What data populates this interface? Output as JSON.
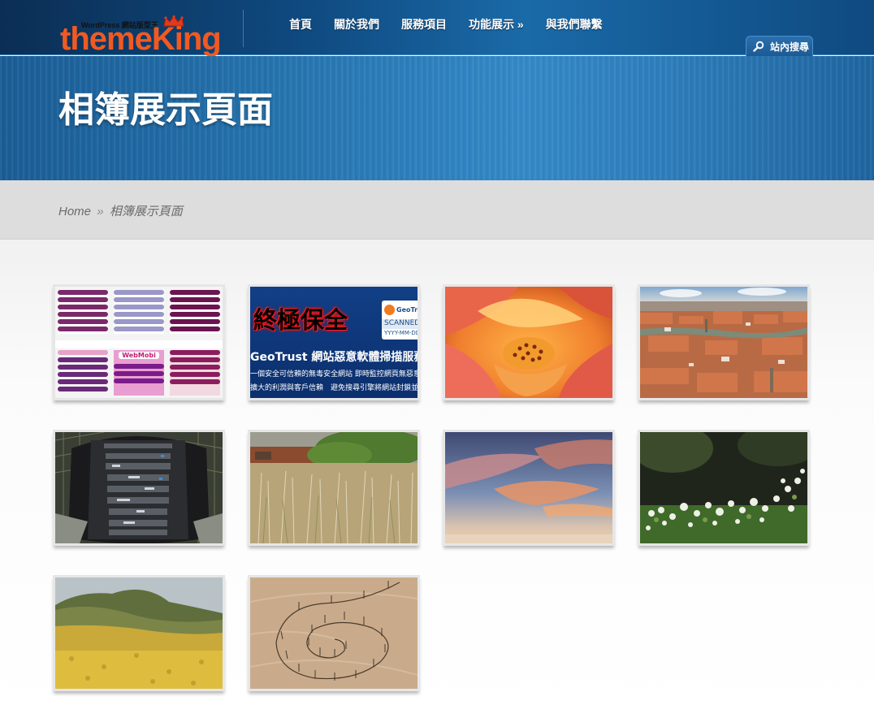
{
  "header": {
    "logo_tagline": "WordPress 網站版型王",
    "logo_text": "themeKing",
    "nav": [
      {
        "label": "首頁"
      },
      {
        "label": "關於我們"
      },
      {
        "label": "服務項目"
      },
      {
        "label": "功能展示 »"
      },
      {
        "label": "與我們聯繫"
      }
    ],
    "search_label": "站內搜尋"
  },
  "banner": {
    "title": "相簿展示頁面"
  },
  "breadcrumb": {
    "home": "Home",
    "separator": "»",
    "current": "相簿展示頁面"
  },
  "gallery": {
    "items": [
      {
        "subject": "website-screenshots",
        "texts": {
          "brand": "WebMobi"
        }
      },
      {
        "subject": "geotrust-banner",
        "texts": {
          "headline": "終極保全",
          "badge_brand": "GeoTrust",
          "badge_status": "SCANNED",
          "badge_date": "YYYY-MM-DD",
          "line1": "GeoTrust 網站惡意軟體掃描服務",
          "line2": "一個安全可信賴的無毒安全網站 即時監控網頁無惡意",
          "line3": "擴大的利潤與客戶信賴　避免搜尋引擎將網站封鎖並列"
        }
      },
      {
        "subject": "orange-rose"
      },
      {
        "subject": "city-rooftops"
      },
      {
        "subject": "server-rack"
      },
      {
        "subject": "dry-grass-field"
      },
      {
        "subject": "sunset-clouds"
      },
      {
        "subject": "white-flowers"
      },
      {
        "subject": "hills-yellow-wildflowers"
      },
      {
        "subject": "sand-spiral-fence"
      }
    ]
  },
  "colors": {
    "header_bg": "#0f4a80",
    "banner_bg": "#2e7fbd",
    "breadcrumb_bg": "#dddddd",
    "logo_orange": "#f05a22",
    "thumb_border": "#e6e6e6"
  },
  "icons": {
    "search": "magnifier-icon",
    "crown": "crown-icon"
  }
}
